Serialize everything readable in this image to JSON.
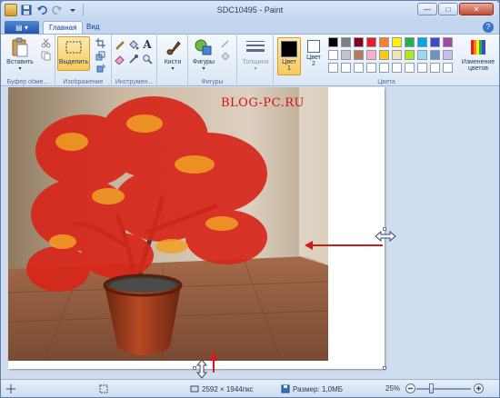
{
  "window": {
    "title": "SDC10495 - Paint",
    "minimize_glyph": "—",
    "maximize_glyph": "□",
    "close_glyph": "✕"
  },
  "ribbon_tabs": {
    "file_menu": "▤ ▾",
    "tabs": [
      "Главная",
      "Вид"
    ],
    "active": "Главная",
    "help": "?"
  },
  "groups": {
    "clipboard": {
      "label": "Буфер обме...",
      "paste": "Вставить"
    },
    "image": {
      "label": "Изображение",
      "select": "Выделить"
    },
    "tools": {
      "label": "Инструмен..."
    },
    "brushes": {
      "label": "Кисти"
    },
    "shapes": {
      "label": "Фигуры",
      "button": "Фигуры"
    },
    "size": {
      "label": "Толщина"
    },
    "colors": {
      "label": "Цвета",
      "color1": "Цвет\n1",
      "color1_a": "Цвет",
      "color1_b": "1",
      "color2_a": "Цвет",
      "color2_b": "2",
      "edit_colors_a": "Изменение",
      "edit_colors_b": "цветов",
      "color1_value": "#000000",
      "color2_value": "#ffffff",
      "palette_row1": [
        "#000000",
        "#7f7f7f",
        "#880015",
        "#ed1c24",
        "#ff7f27",
        "#fff200",
        "#22b14c",
        "#00a2e8",
        "#3f48cc",
        "#a349a4"
      ],
      "palette_row2": [
        "#ffffff",
        "#c3c3c3",
        "#b97a57",
        "#ffaec9",
        "#ffc90e",
        "#efe4b0",
        "#b5e61d",
        "#99d9ea",
        "#7092be",
        "#c8bfe7"
      ]
    }
  },
  "canvas": {
    "watermark": "BLOG-PC.RU"
  },
  "statusbar": {
    "dimensions": "2592 × 1944пкс",
    "size": "Размер: 1,0МБ",
    "zoom": "25%",
    "zoom_level": 0.25
  }
}
